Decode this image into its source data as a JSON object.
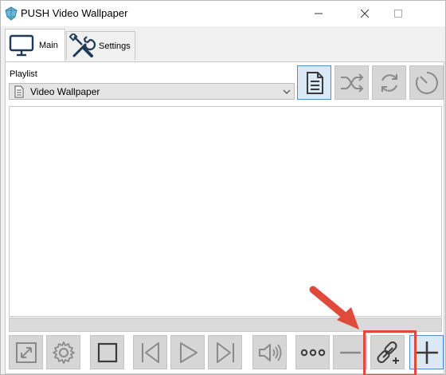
{
  "window": {
    "title": "PUSH Video Wallpaper",
    "controls": [
      "minimize",
      "maximize",
      "close"
    ]
  },
  "tabs": [
    {
      "label": "Main",
      "icon": "monitor-icon",
      "selected": true
    },
    {
      "label": "Settings",
      "icon": "tools-icon",
      "selected": false
    }
  ],
  "playlist": {
    "label": "Playlist",
    "selected_value": "Video Wallpaper"
  },
  "toolbar_top": [
    {
      "name": "playlist-doc-button",
      "icon": "document-icon",
      "active": true
    },
    {
      "name": "shuffle-button",
      "icon": "shuffle-icon",
      "active": false
    },
    {
      "name": "repeat-button",
      "icon": "refresh-icon",
      "active": false
    },
    {
      "name": "timer-button",
      "icon": "clock-icon",
      "active": false
    }
  ],
  "toolbar_bottom": [
    {
      "name": "fullscreen-button",
      "icon": "expand-icon"
    },
    {
      "name": "settings-button",
      "icon": "gear-icon"
    },
    {
      "name": "stop-button",
      "icon": "stop-icon"
    },
    {
      "name": "previous-button",
      "icon": "skip-back-icon"
    },
    {
      "name": "play-button",
      "icon": "play-icon"
    },
    {
      "name": "next-button",
      "icon": "skip-forward-icon"
    },
    {
      "name": "volume-button",
      "icon": "speaker-icon"
    },
    {
      "name": "more-button",
      "icon": "ellipsis-icon"
    },
    {
      "name": "remove-button",
      "icon": "minus-icon"
    },
    {
      "name": "add-url-button",
      "icon": "link-plus-icon"
    },
    {
      "name": "add-file-button",
      "icon": "plus-icon"
    }
  ],
  "colors": {
    "accent_blue": "#5a8dc7",
    "highlight_red": "#e04a3a",
    "icon_gray": "#8a8a8a",
    "button_gray": "#d6d6d6"
  }
}
